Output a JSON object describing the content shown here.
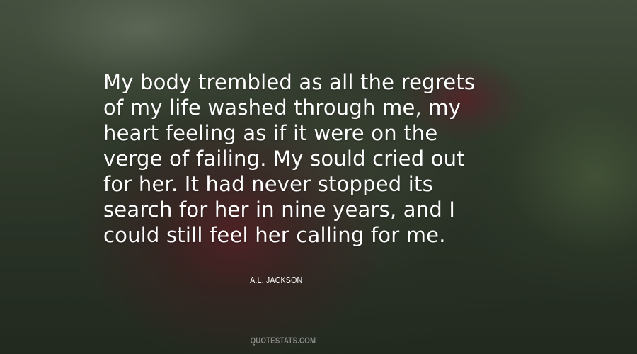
{
  "quote": {
    "lines": [
      "My body trembled as all the regrets",
      "of my life washed through me, my",
      "heart feeling as if it were on the",
      "verge of failing. My sould cried out",
      "for her. It had never stopped its",
      "search for her in nine years, and I",
      "could still feel her calling for me."
    ]
  },
  "author": "A.L. JACKSON",
  "watermark": "QUOTESTATS.COM",
  "background": {
    "description_colors": {
      "green": "#48563f",
      "red_flower": "#7a2832"
    }
  }
}
